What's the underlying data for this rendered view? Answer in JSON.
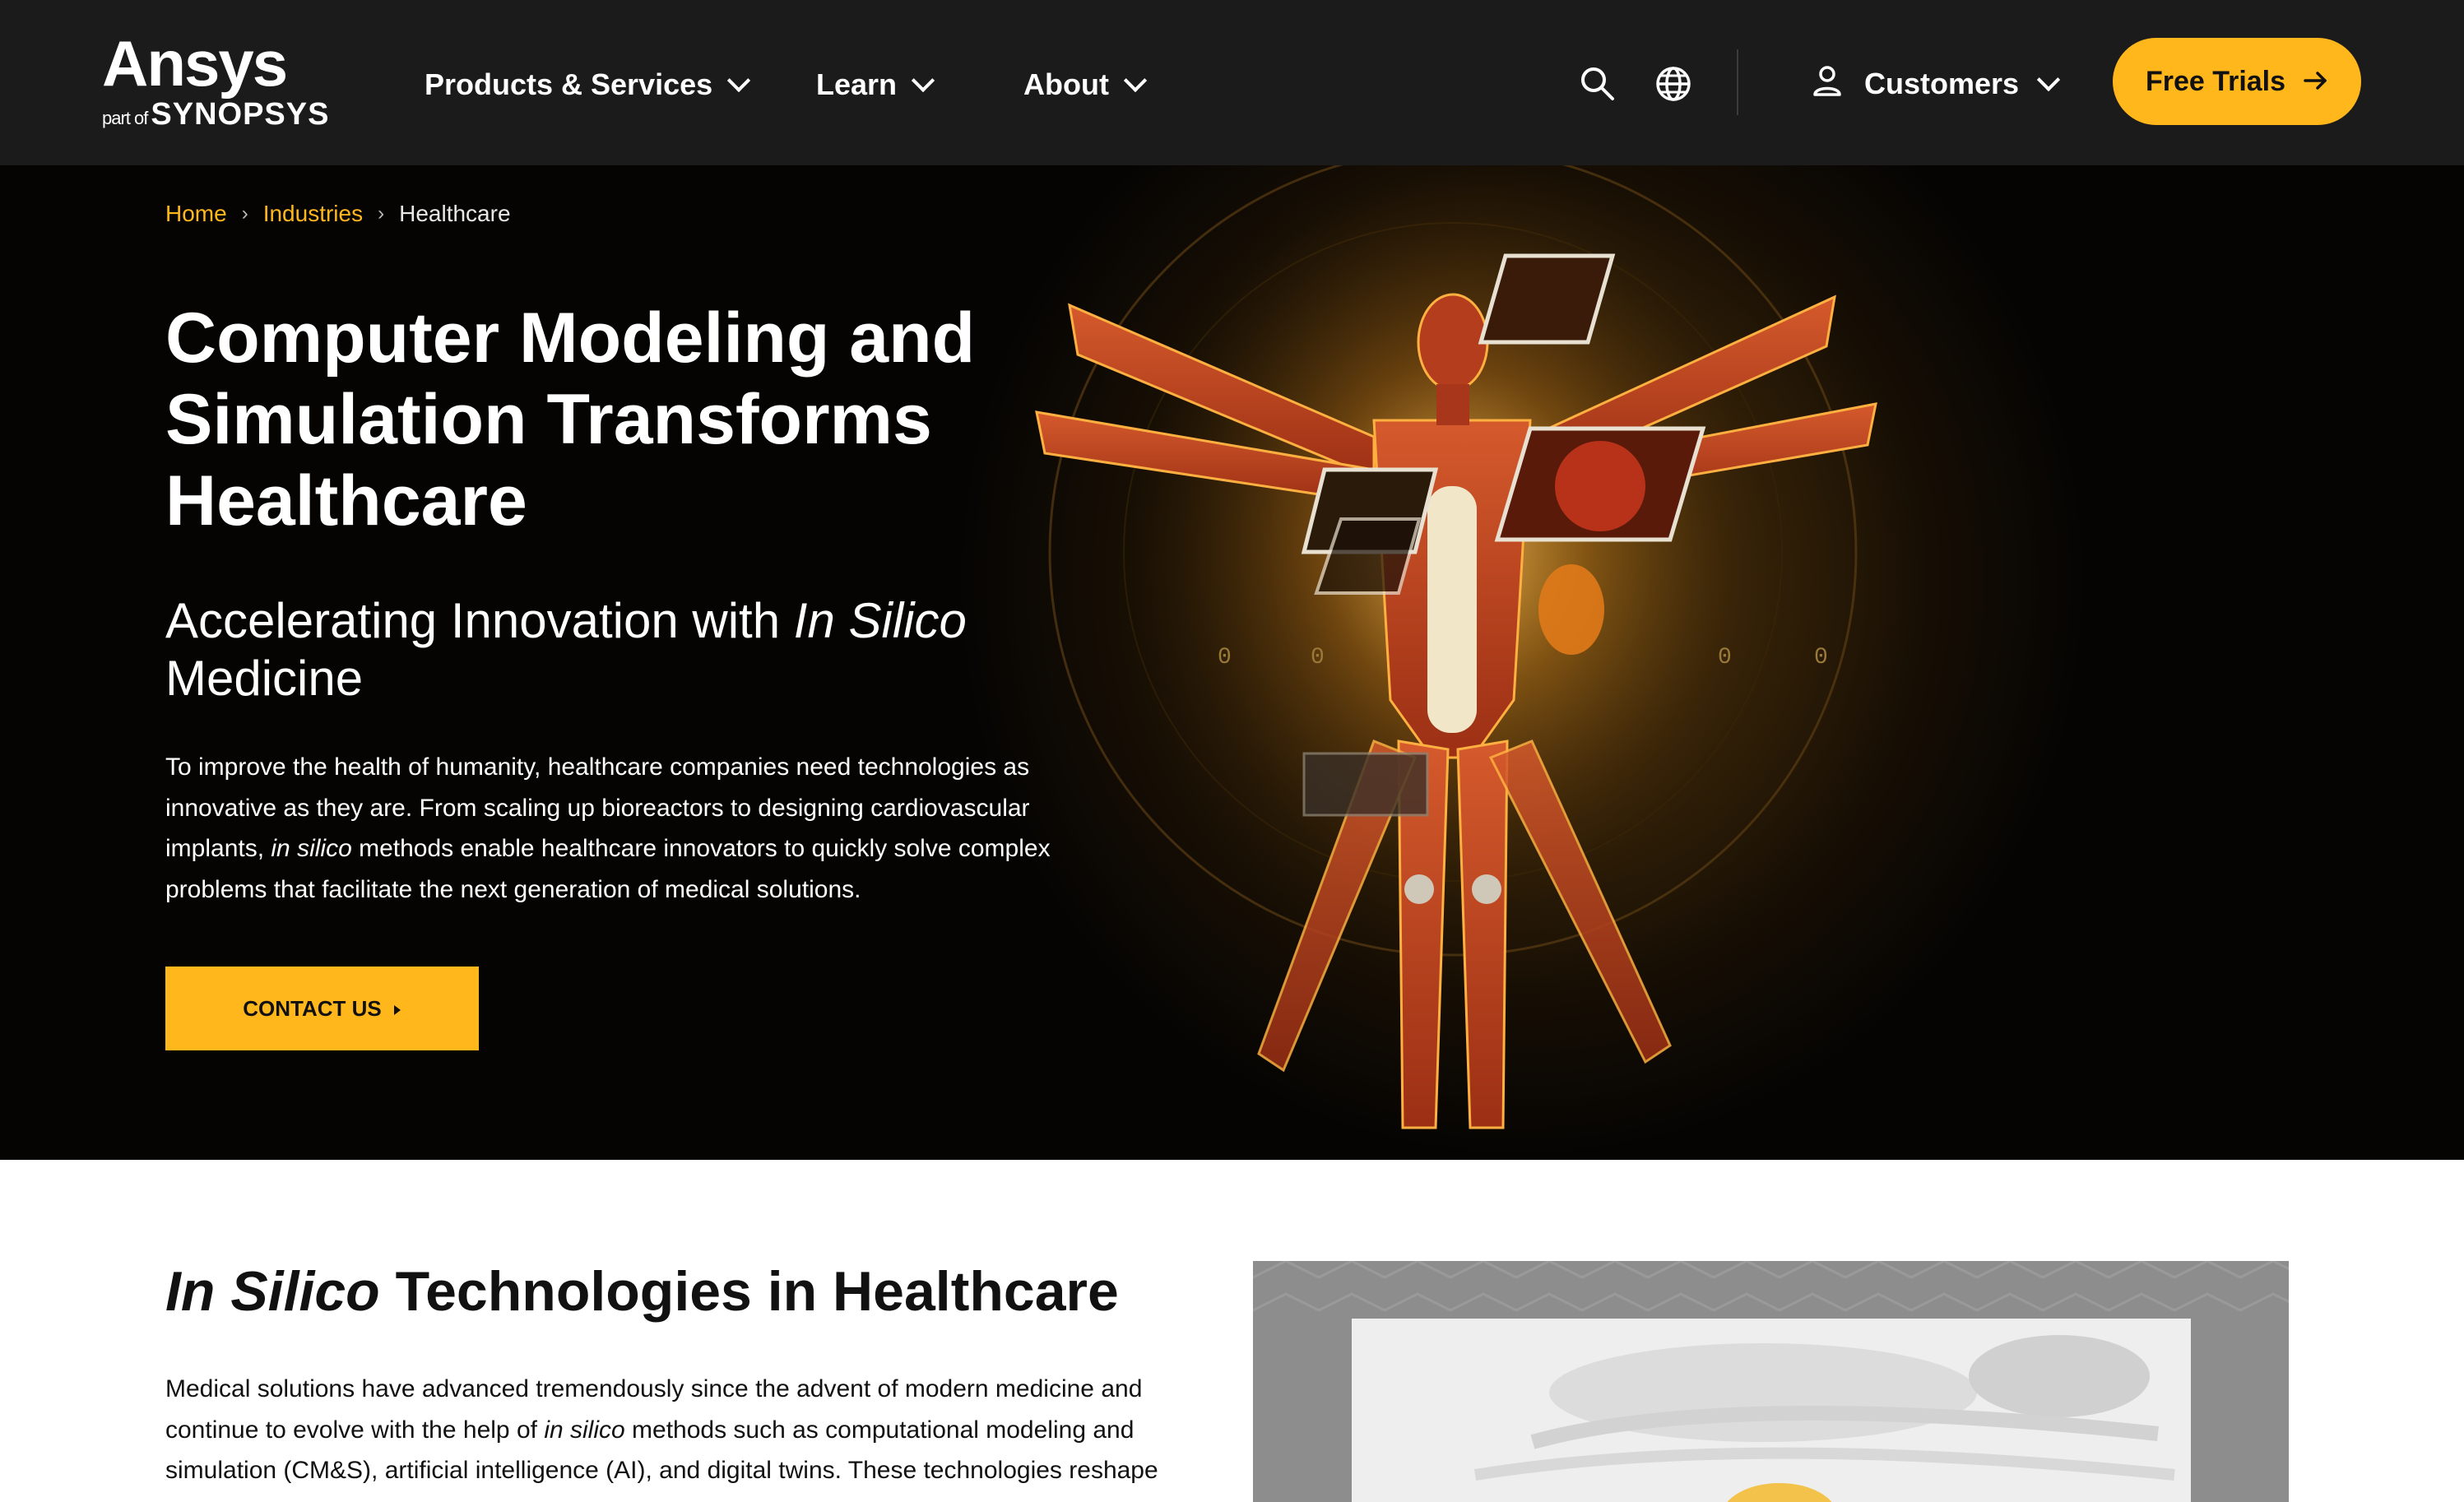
{
  "brand": {
    "logo_text": "Ansys",
    "logo_part_of": "part of",
    "logo_parent": "SYNOPSYS"
  },
  "nav": {
    "items": [
      {
        "label": "Products & Services"
      },
      {
        "label": "Learn"
      },
      {
        "label": "About"
      }
    ],
    "search_icon": "search-icon",
    "globe_icon": "globe-icon",
    "customers_label": "Customers",
    "free_trials_label": "Free Trials"
  },
  "breadcrumb": {
    "home": "Home",
    "industries": "Industries",
    "current": "Healthcare",
    "separator": "›"
  },
  "hero": {
    "title": "Computer Modeling and Simulation Transforms Healthcare",
    "subtitle_prefix": "Accelerating Innovation with ",
    "subtitle_italic": "In Silico",
    "subtitle_suffix": " Medicine",
    "body_part1": "To improve the health of humanity, healthcare companies need technologies as innovative as they are. From scaling up bioreactors to designing cardiovascular implants, ",
    "body_italic": "in silico",
    "body_part2": " methods enable healthcare innovators to quickly solve complex problems that facilitate the next generation of medical solutions.",
    "cta_label": "CONTACT US"
  },
  "section": {
    "title_italic": "In Silico",
    "title_rest": " Technologies in Healthcare",
    "body_part1": "Medical solutions have advanced tremendously since the advent of modern medicine and continue to evolve with the help of ",
    "body_italic": "in silico",
    "body_part2": " methods such as computational modeling and simulation (CM&S), artificial intelligence (AI), and digital twins. These technologies reshape"
  },
  "colors": {
    "accent": "#ffb71b",
    "header_bg": "#1b1b1b",
    "hero_bg": "#050403"
  }
}
